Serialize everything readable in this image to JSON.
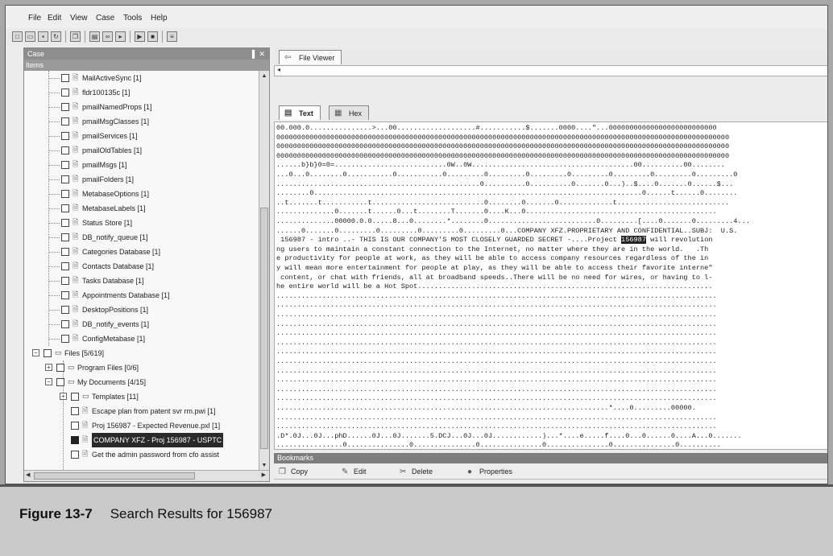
{
  "menu": [
    "File",
    "Edit",
    "View",
    "Case",
    "Tools",
    "Help"
  ],
  "case_pane": {
    "title": "Case",
    "pin_glyph": "▐",
    "close_glyph": "✕",
    "header": "Items",
    "items": [
      {
        "label": "MailActiveSync [1]"
      },
      {
        "label": "fldr100135c [1]"
      },
      {
        "label": "pmailNamedProps [1]"
      },
      {
        "label": "pmailMsgClasses [1]"
      },
      {
        "label": "pmailServices [1]"
      },
      {
        "label": "pmailOldTables [1]"
      },
      {
        "label": "pmailMsgs [1]"
      },
      {
        "label": "pmailFolders [1]"
      },
      {
        "label": "MetabaseOptions [1]"
      },
      {
        "label": "MetabaseLabels [1]"
      },
      {
        "label": "Status Store [1]"
      },
      {
        "label": "DB_notify_queue [1]"
      },
      {
        "label": "Categories Database [1]"
      },
      {
        "label": "Contacts Database [1]"
      },
      {
        "label": "Tasks Database [1]"
      },
      {
        "label": "Appointments Database [1]"
      },
      {
        "label": "DesktopPositions [1]"
      },
      {
        "label": "DB_notify_events [1]"
      },
      {
        "label": "ConfigMetabase [1]"
      },
      {
        "label": "Files [5/619]"
      },
      {
        "label": "Program Files [0/6]"
      },
      {
        "label": "My Documents [4/15]"
      },
      {
        "label": "Templates [11]"
      },
      {
        "label": "Escape plan from patent svr rm.pwi [1]"
      },
      {
        "label": "Proj 156987 - Expected Revenue.pxl [1]"
      },
      {
        "label": "COMPANY XFZ - Proj 156987 - USPTC"
      },
      {
        "label": "Get the admin password from cfo assist"
      }
    ]
  },
  "viewer": {
    "tab": "File Viewer",
    "strip_glyph": "◂",
    "subtabs": [
      "Text",
      "Hex"
    ],
    "lines": [
      {
        "text": "00.000.0...............>...00...................#...........$.......0000....\"...00000000000000000000000000"
      },
      {
        "text": "0000000000000000000000000000000000000000000000000000000000000000000000000000000000000000000000000000000000000"
      },
      {
        "text": "0000000000000000000000000000000000000000000000000000000000000000000000000000000000000000000000000000000000000"
      },
      {
        "text": "0000000000000000000000000000000000000000000000000000000000000000000000000000000000000000000000000000000000000"
      },
      {
        "text": "......b}b}0=0=...........................0W..0W.......................................00..........00........"
      },
      {
        "text": "...0...0........0...........0...........0.........0.........0.........0.........0.........0.........0.........0"
      },
      {
        "text": ".................................................0..........0..........0.......0...)..$....0.......0......$..."
      },
      {
        "text": "........0...............................................................................0......t......0........"
      },
      {
        "text": "..t.......t...........t...........................0........0.......0.............t..........................."
      },
      {
        "text": "..............0.......t......0...t........T.......0....K...0.............................................."
      },
      {
        "text": "..............00000.0.0.....8...0........*........0..........................0.........[....0.......0.........4..."
      },
      {
        "text": "......0.......0.........0.........0.........0.........0...COMPANY XFZ.PROPRIETARY AND CONFIDENTIAL..SUBJ:  U.S."
      },
      {
        "text": " 156987 - intro ..- THIS IS OUR COMPANY'S MOST CLOSELY GUARDED SECRET -....Project ",
        "hl": "156987",
        "after": " will revolution"
      },
      {
        "text": "ng users to maintain a constant connection to the Internet, no matter where they are in the world.   .Th"
      },
      {
        "text": "e productivity for people at work, as they will be able to access company resources regardless of the in"
      },
      {
        "text": "y will mean more entertainment for people at play, as they will be able to access their favorite interne\""
      },
      {
        "text": " content, or chat with friends, all at broadband speeds..There will be no need for wires, or having to l-"
      },
      {
        "text": "he entire world will be a Hot Spot......................................................................."
      },
      {
        "text": ".........................................................................................................."
      },
      {
        "text": ".........................................................................................................."
      },
      {
        "text": ".........................................................................................................."
      },
      {
        "text": ".........................................................................................................."
      },
      {
        "text": ".........................................................................................................."
      },
      {
        "text": ".........................................................................................................."
      },
      {
        "text": ".........................................................................................................."
      },
      {
        "text": ".........................................................................................................."
      },
      {
        "text": ".........................................................................................................."
      },
      {
        "text": ".........................................................................................................."
      },
      {
        "text": ".........................................................................................................."
      },
      {
        "text": ".........................................................................................................."
      },
      {
        "text": "................................................................................*....0.........00000."
      },
      {
        "text": ".........................................................................................................."
      },
      {
        "text": ".........................................................................................................."
      },
      {
        "text": ".D*.0J...0J...phD......0J...0J.......5.DCJ...0J...0J............)...*....e.....f....0...0......0....A...0......."
      },
      {
        "text": "................0...............0...............0...............0...............0...............0.........."
      }
    ]
  },
  "bookmarks": {
    "title": "Bookmarks",
    "actions": [
      "Copy",
      "Edit",
      "Delete",
      "Properties"
    ]
  },
  "caption": {
    "figure": "Figure 13-7",
    "text": "Search Results for 156987"
  }
}
